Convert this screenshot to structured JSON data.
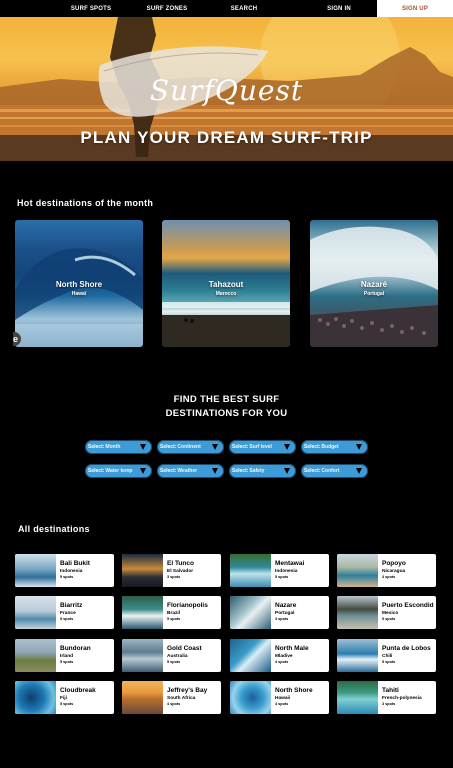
{
  "nav": {
    "spots": "SURF SPOTS",
    "zones": "SURF ZONES",
    "search": "SEARCH",
    "signin": "SIGN IN",
    "signup": "SIGN UP"
  },
  "hero": {
    "brand": "SurfQuest",
    "title": "PLAN YOUR DREAM SURF-TRIP"
  },
  "hot": {
    "title": "Hot destinations of the month",
    "cards": [
      {
        "name": "North Shore",
        "country": "Hawaï"
      },
      {
        "name": "Tahazout",
        "country": "Marocco"
      },
      {
        "name": "Nazaré",
        "country": "Portugal"
      }
    ],
    "tab_glyph": "e"
  },
  "finder": {
    "title_line1": "FIND THE BEST SURF",
    "title_line2": "DESTINATIONS FOR YOU",
    "prefix": "Select:",
    "filters": [
      "Month",
      "Continent",
      "Surf level",
      "Budget",
      "Water temp",
      "Weather",
      "Safety",
      "Confort"
    ]
  },
  "all": {
    "title": "All destinations",
    "items": [
      {
        "name": "Bali Bukit",
        "country": "Indonesia",
        "spots": "5 spots"
      },
      {
        "name": "El Tunco",
        "country": "El Salvador",
        "spots": "3 spots"
      },
      {
        "name": "Mentawai",
        "country": "Indonesia",
        "spots": "5 spots"
      },
      {
        "name": "Popoyo",
        "country": "Nicaragua",
        "spots": "3 spots"
      },
      {
        "name": "Biarritz",
        "country": "France",
        "spots": "5 spots"
      },
      {
        "name": "Florianopolis",
        "country": "Brazil",
        "spots": "5 spots"
      },
      {
        "name": "Nazare",
        "country": "Portugal",
        "spots": "3 spots"
      },
      {
        "name": "Puerto Escondid",
        "country": "Mexico",
        "spots": "5 spots"
      },
      {
        "name": "Bundoran",
        "country": "Irland",
        "spots": "5 spots"
      },
      {
        "name": "Gold Coast",
        "country": "Australia",
        "spots": "5 spots"
      },
      {
        "name": "North Male",
        "country": "Mladive",
        "spots": "4 spots"
      },
      {
        "name": "Punta de Lobos",
        "country": "Chili",
        "spots": "5 spots"
      },
      {
        "name": "Cloudbreak",
        "country": "Fiji",
        "spots": "5 spots"
      },
      {
        "name": "Jeffrey's Bay",
        "country": "South Africa",
        "spots": "4 spots"
      },
      {
        "name": "North Shore",
        "country": "Hawaii",
        "spots": "4 spots"
      },
      {
        "name": "Tahiti",
        "country": "French-polynesia",
        "spots": "3 spots"
      }
    ]
  },
  "colors": {
    "select_bg": "#3d9cd8",
    "signup_text": "#a0522d",
    "background": "#000000"
  }
}
